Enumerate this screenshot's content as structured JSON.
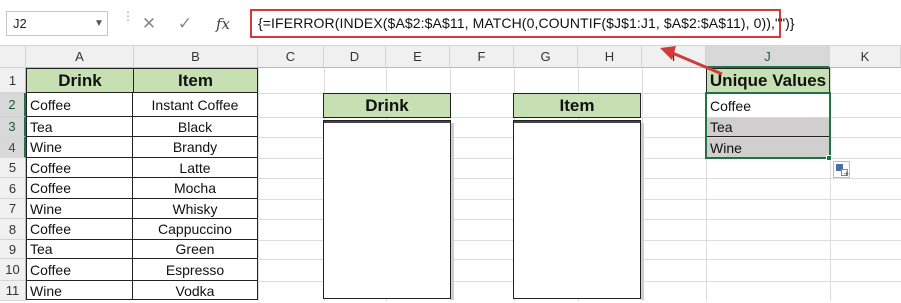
{
  "formula_bar": {
    "name_box": "J2",
    "cancel_icon": "✕",
    "enter_icon": "✓",
    "fx_label": "fx",
    "formula": "{=IFERROR(INDEX($A$2:$A$11, MATCH(0,COUNTIF($J$1:J1, $A$2:$A$11), 0)),\"\")}"
  },
  "columns": [
    "A",
    "B",
    "C",
    "D",
    "E",
    "F",
    "G",
    "H",
    "I",
    "J",
    "K"
  ],
  "rows": [
    "1",
    "2",
    "3",
    "4",
    "5",
    "6",
    "7",
    "8",
    "9",
    "10",
    "11"
  ],
  "table": {
    "headers": {
      "drink": "Drink",
      "item": "Item"
    },
    "data": [
      {
        "drink": "Coffee",
        "item": "Instant Coffee"
      },
      {
        "drink": "Tea",
        "item": "Black"
      },
      {
        "drink": "Wine",
        "item": "Brandy"
      },
      {
        "drink": "Coffee",
        "item": "Latte"
      },
      {
        "drink": "Coffee",
        "item": "Mocha"
      },
      {
        "drink": "Wine",
        "item": "Whisky"
      },
      {
        "drink": "Coffee",
        "item": "Cappuccino"
      },
      {
        "drink": "Tea",
        "item": "Green"
      },
      {
        "drink": "Coffee",
        "item": "Espresso"
      },
      {
        "drink": "Wine",
        "item": "Vodka"
      }
    ]
  },
  "box_drink": {
    "header": "Drink"
  },
  "box_item": {
    "header": "Item"
  },
  "unique": {
    "header": "Unique Values",
    "values": [
      "Coffee",
      "Tea",
      "Wine"
    ]
  },
  "colors": {
    "header_fill": "#c6e0b4",
    "selection_green": "#217346",
    "arrow_red": "#d23b3b",
    "grey_fill": "#d0cece"
  },
  "icons": {
    "dropdown": "chevron-down-icon",
    "paste_options": "paste-options-icon",
    "arrow": "red-arrow-icon"
  }
}
